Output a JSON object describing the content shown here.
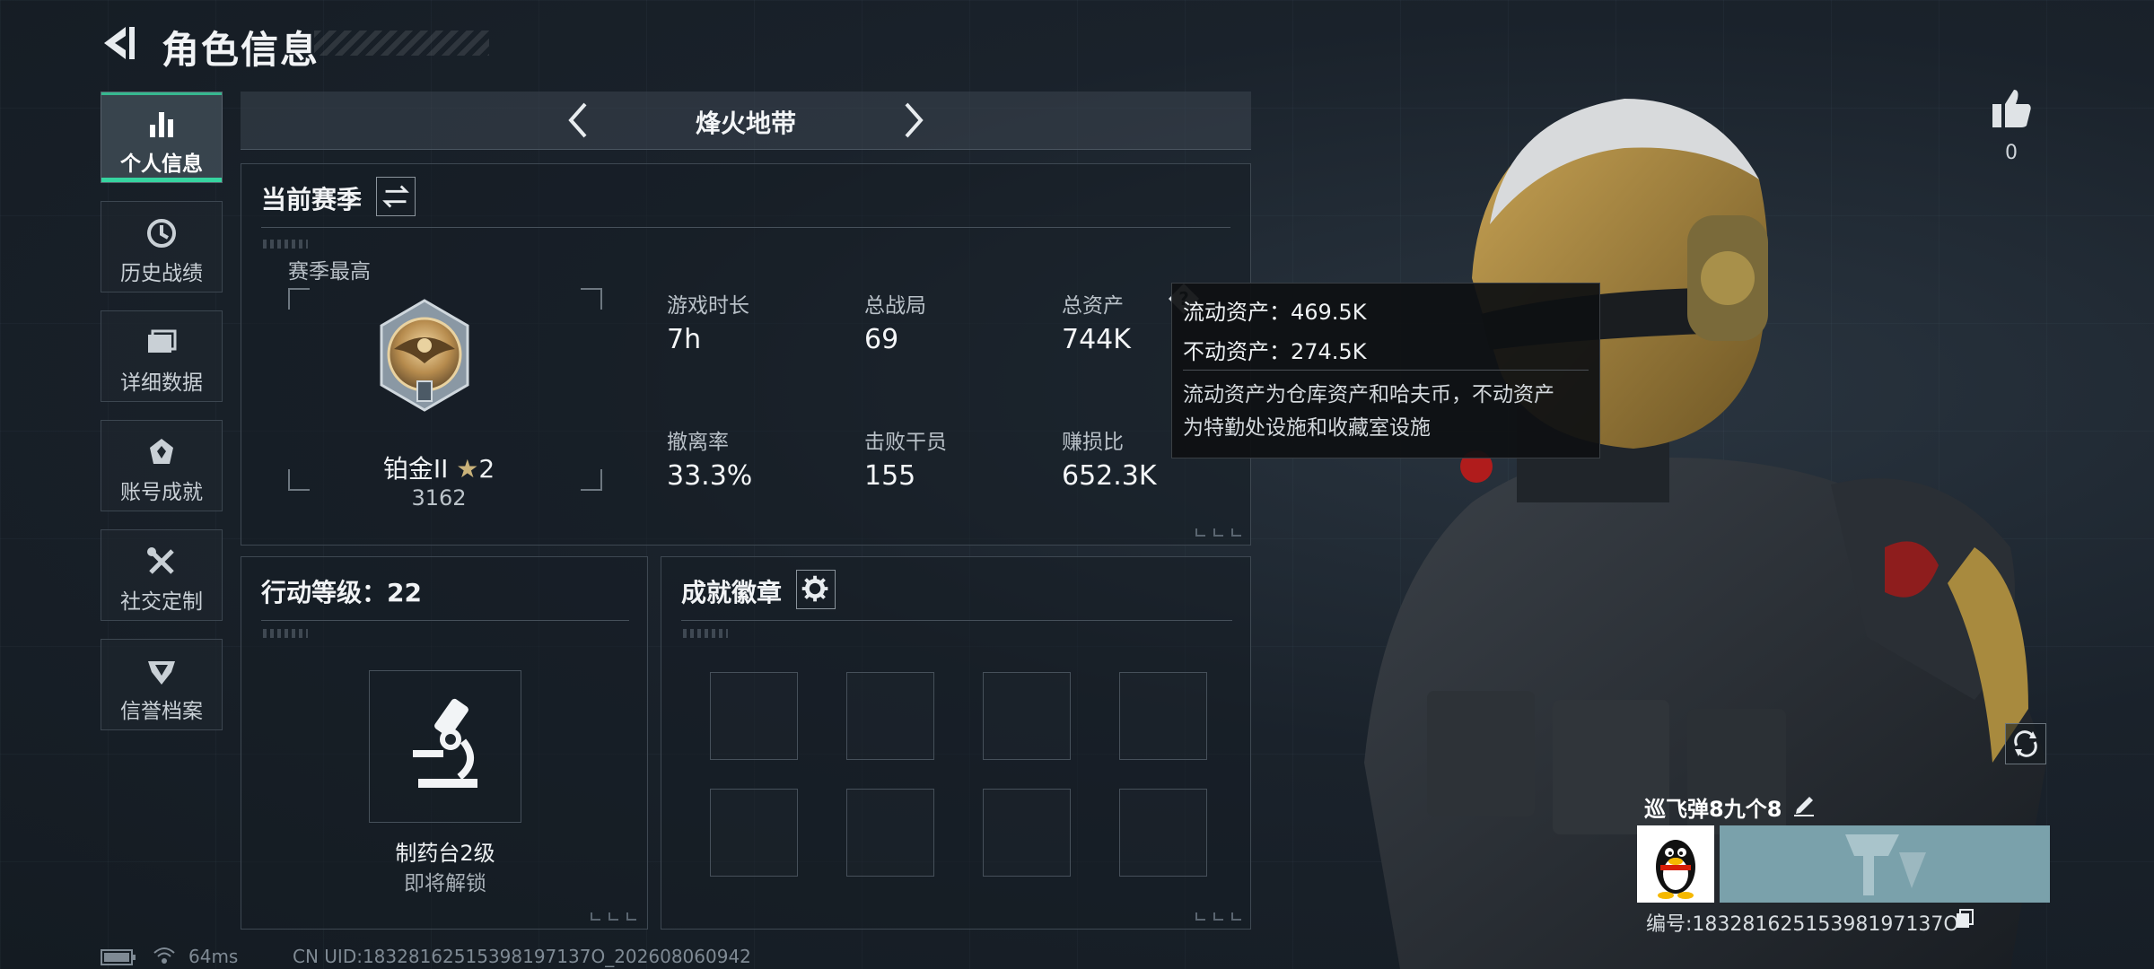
{
  "header": {
    "title": "角色信息",
    "back_icon": "back-arrow-icon"
  },
  "sidebar": {
    "accent_color": "#36d4a0",
    "items": [
      {
        "label": "个人信息",
        "icon": "bar-chart-icon",
        "active": true
      },
      {
        "label": "历史战绩",
        "icon": "history-clock-icon",
        "active": false
      },
      {
        "label": "详细数据",
        "icon": "folder-icon",
        "active": false
      },
      {
        "label": "账号成就",
        "icon": "achievement-icon",
        "active": false
      },
      {
        "label": "社交定制",
        "icon": "tools-icon",
        "active": false
      },
      {
        "label": "信誉档案",
        "icon": "shield-icon",
        "active": false
      }
    ]
  },
  "mode_selector": {
    "label": "烽火地带",
    "prev_icon": "chevron-left-icon",
    "next_icon": "chevron-right-icon"
  },
  "season": {
    "title": "当前赛季",
    "switch_icon": "swap-icon",
    "best_label": "赛季最高",
    "rank_name": "铂金II",
    "rank_stars": "2",
    "rank_points": "3162",
    "stats": [
      {
        "label": "游戏时长",
        "value": "7h"
      },
      {
        "label": "总战局",
        "value": "69"
      },
      {
        "label": "总资产",
        "value": "744K"
      },
      {
        "label": "撤离率",
        "value": "33.3%"
      },
      {
        "label": "击败干员",
        "value": "155"
      },
      {
        "label": "赚损比",
        "value": "652.3K"
      }
    ]
  },
  "tooltip": {
    "liquid": "流动资产：469.5K",
    "fixed": "不动资产：274.5K",
    "note_line1": "流动资产为仓库资产和哈夫币，不动资产",
    "note_line2": "为特勤处设施和收藏室设施"
  },
  "action_level": {
    "title": "行动等级：22",
    "item_name": "制药台2级",
    "item_status": "即将解锁",
    "item_icon": "microscope-icon"
  },
  "badges": {
    "title": "成就徽章",
    "settings_icon": "gear-icon",
    "slot_count": 8
  },
  "player": {
    "likes": "0",
    "name": "巡飞弹8九个8",
    "id_text": "编号:18328162515398197137O",
    "avatar_icon": "qq-penguin-icon"
  },
  "footer": {
    "ping": "64ms",
    "uid": "CN UID:18328162515398197137O_202608060942"
  }
}
